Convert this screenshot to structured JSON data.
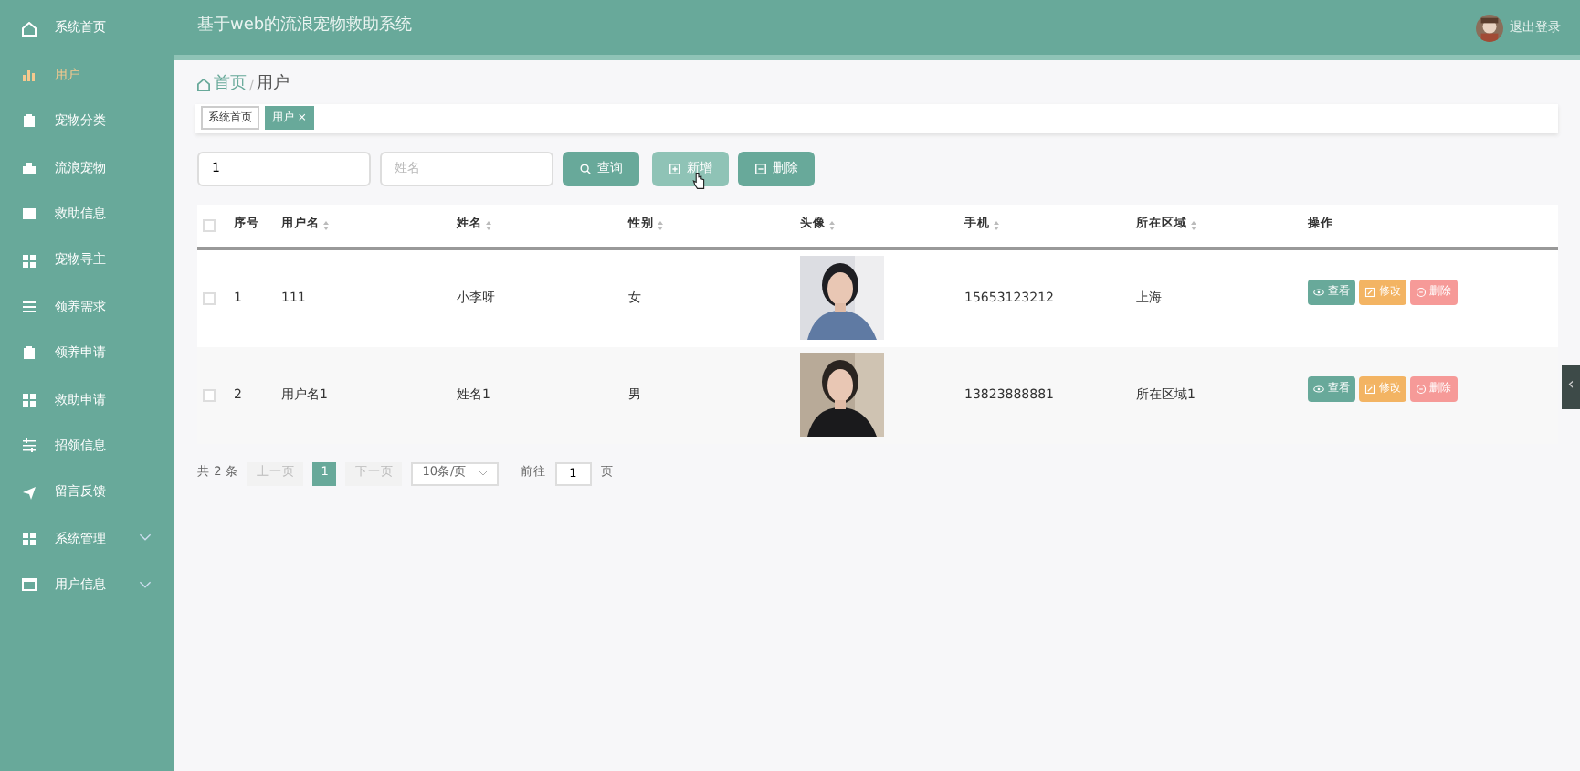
{
  "header": {
    "title": "基于web的流浪宠物救助系统",
    "logout": "退出登录"
  },
  "sidebar": {
    "items": [
      {
        "label": "系统首页",
        "selected": false,
        "expandable": false
      },
      {
        "label": "用户",
        "selected": true,
        "expandable": false
      },
      {
        "label": "宠物分类",
        "selected": false,
        "expandable": false
      },
      {
        "label": "流浪宠物",
        "selected": false,
        "expandable": false
      },
      {
        "label": "救助信息",
        "selected": false,
        "expandable": false
      },
      {
        "label": "宠物寻主",
        "selected": false,
        "expandable": false
      },
      {
        "label": "领养需求",
        "selected": false,
        "expandable": false
      },
      {
        "label": "领养申请",
        "selected": false,
        "expandable": false
      },
      {
        "label": "救助申请",
        "selected": false,
        "expandable": false
      },
      {
        "label": "招领信息",
        "selected": false,
        "expandable": false
      },
      {
        "label": "留言反馈",
        "selected": false,
        "expandable": false
      },
      {
        "label": "系统管理",
        "selected": false,
        "expandable": true
      },
      {
        "label": "用户信息",
        "selected": false,
        "expandable": true
      }
    ]
  },
  "breadcrumb": {
    "home": "首页",
    "separator": "/",
    "current": "用户"
  },
  "tags": [
    {
      "label": "系统首页",
      "selected": false
    },
    {
      "label": "用户",
      "selected": true,
      "close": "×"
    }
  ],
  "search": {
    "fields": [
      {
        "value": "1"
      },
      {
        "placeholder": "姓名"
      }
    ],
    "buttons": [
      {
        "label": "查询",
        "kind": "search",
        "hovered": false
      },
      {
        "label": "新增",
        "kind": "add",
        "hovered": true
      },
      {
        "label": "删除",
        "kind": "delete",
        "hovered": false
      }
    ]
  },
  "table": {
    "select_all": {
      "checked": false
    },
    "columns": [
      {
        "label": "序号",
        "sortable": false
      },
      {
        "label": "用户名",
        "sortable": true
      },
      {
        "label": "姓名",
        "sortable": true
      },
      {
        "label": "性别",
        "sortable": true
      },
      {
        "label": "头像",
        "sortable": true
      },
      {
        "label": "手机",
        "sortable": true
      },
      {
        "label": "所在区域",
        "sortable": true
      },
      {
        "label": "操作",
        "sortable": false
      }
    ],
    "rows": [
      {
        "checked": false,
        "cells": [
          "1",
          "111",
          "小李呀",
          "女",
          {
            "kind": "picture"
          },
          "15653123212",
          "上海"
        ],
        "actions": [
          {
            "label": "查看",
            "kind": "view"
          },
          {
            "label": "修改",
            "kind": "edit"
          },
          {
            "label": "删除",
            "kind": "delete"
          }
        ]
      },
      {
        "checked": false,
        "cells": [
          "2",
          "用户名1",
          "姓名1",
          "男",
          {
            "kind": "picture"
          },
          "13823888881",
          "所在区域1"
        ],
        "actions": [
          {
            "label": "查看",
            "kind": "view"
          },
          {
            "label": "修改",
            "kind": "edit"
          },
          {
            "label": "删除",
            "kind": "delete"
          }
        ]
      }
    ]
  },
  "pagination": {
    "total": "共 2 条",
    "prev": "上一页",
    "pages": [
      {
        "label": "1",
        "selected": true
      }
    ],
    "next": "下一页",
    "page_size": "10条/页",
    "goto": "前往",
    "goto_value": "1",
    "page_unit": "页"
  },
  "side_tab": {
    "label": "‹"
  }
}
